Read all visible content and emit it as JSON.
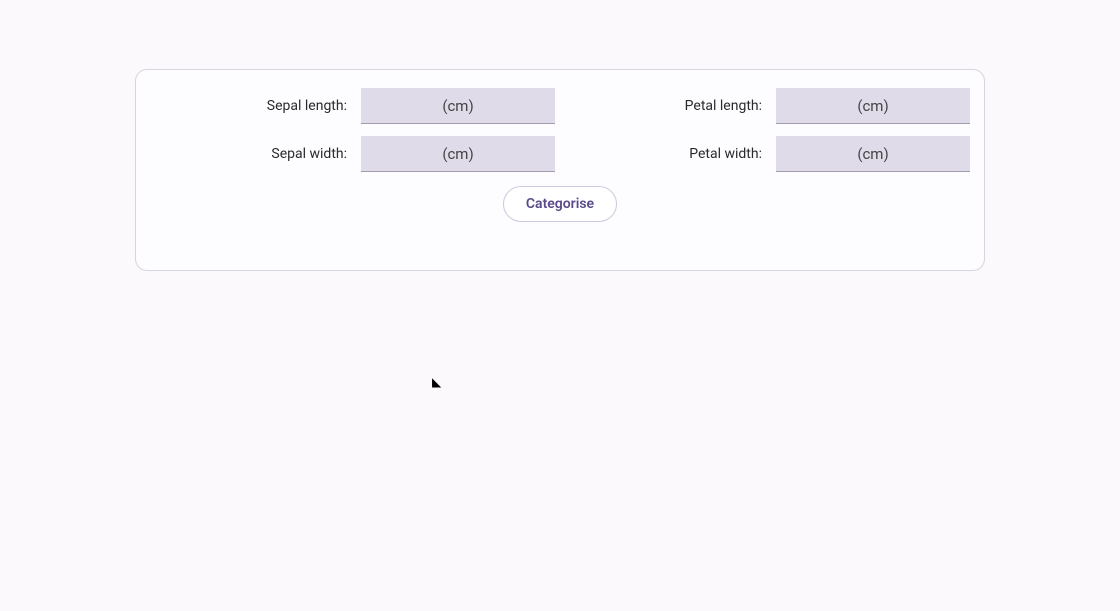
{
  "form": {
    "fields": [
      {
        "label": "Sepal length:",
        "placeholder": "(cm)",
        "value": ""
      },
      {
        "label": "Petal length:",
        "placeholder": "(cm)",
        "value": ""
      },
      {
        "label": "Sepal width:",
        "placeholder": "(cm)",
        "value": ""
      },
      {
        "label": "Petal width:",
        "placeholder": "(cm)",
        "value": ""
      }
    ],
    "button_label": "Categorise"
  }
}
